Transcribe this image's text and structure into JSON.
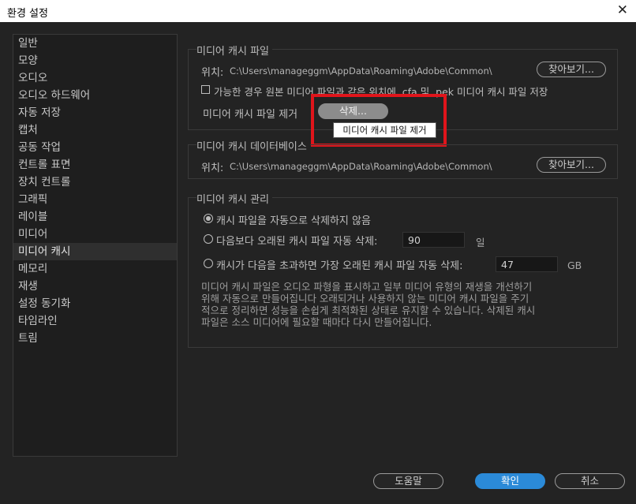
{
  "window": {
    "title": "환경 설정",
    "close": "✕"
  },
  "sidebar": {
    "items": [
      "일반",
      "모양",
      "오디오",
      "오디오 하드웨어",
      "자동 저장",
      "캡처",
      "공동 작업",
      "컨트롤 표면",
      "장치 컨트롤",
      "그래픽",
      "레이블",
      "미디어",
      "미디어 캐시",
      "메모리",
      "재생",
      "설정 동기화",
      "타임라인",
      "트림"
    ],
    "selected": "미디어 캐시"
  },
  "cache_files": {
    "title": "미디어 캐시 파일",
    "location_label": "위치:",
    "path": "C:\\Users\\manageggm\\AppData\\Roaming\\Adobe\\Common\\",
    "browse": "찾아보기...",
    "save_beside_checkbox": "가능한 경우 원본 미디어 파일과 같은 위치에 .cfa 및 .pek 미디어 캐시 파일 저장",
    "remove_label": "미디어 캐시 파일 제거",
    "delete_button": "삭제...",
    "tooltip": "미디어 캐시 파일 제거"
  },
  "cache_db": {
    "title": "미디어 캐시 데이터베이스",
    "location_label": "위치:",
    "path": "C:\\Users\\manageggm\\AppData\\Roaming\\Adobe\\Common\\",
    "browse": "찾아보기..."
  },
  "cache_mgmt": {
    "title": "미디어 캐시 관리",
    "option1": "캐시 파일을 자동으로 삭제하지 않음",
    "option2": "다음보다 오래된 캐시 파일 자동 삭제:",
    "option2_value": "90",
    "option2_unit": "일",
    "option3": "캐시가 다음을 초과하면 가장 오래된 캐시 파일 자동 삭제:",
    "option3_value": "47",
    "option3_unit": "GB",
    "selected_option": 1,
    "description": "미디어 캐시 파일은 오디오 파형을 표시하고 일부 미디어 유형의 재생을 개선하기 위해 자동으로 만들어집니다 오래되거나 사용하지 않는 미디어 캐시 파일을 주기적으로 정리하면 성능을 손쉽게 최적화된 상태로 유지할 수 있습니다. 삭제된 캐시 파일은 소스 미디어에 필요할 때마다 다시 만들어집니다."
  },
  "footer": {
    "help": "도움말",
    "ok": "확인",
    "cancel": "취소"
  },
  "colors": {
    "accent": "#2b8ad8",
    "highlight": "#e0151b",
    "background": "#232323"
  }
}
